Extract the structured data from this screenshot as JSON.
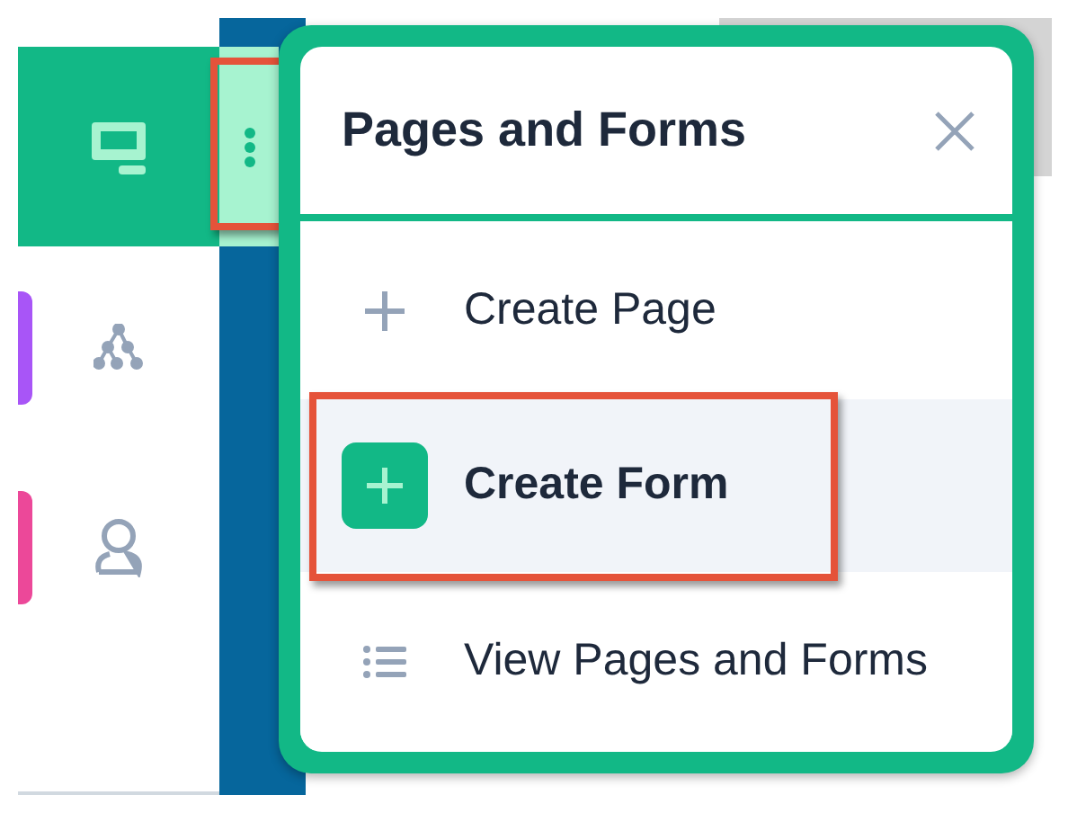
{
  "sidebar": {
    "items": [
      {
        "kind": "display",
        "selected": true
      },
      {
        "kind": "tree",
        "selected": false,
        "color": "#a855f7"
      },
      {
        "kind": "person",
        "selected": false,
        "color": "#ec4899"
      }
    ]
  },
  "menu": {
    "title": "Pages and Forms",
    "items": [
      {
        "label": "Create Page",
        "kind": "plus",
        "selected": false
      },
      {
        "label": "Create Form",
        "kind": "plus",
        "selected": true
      },
      {
        "label": "View Pages and Forms",
        "kind": "list",
        "selected": false
      }
    ]
  }
}
